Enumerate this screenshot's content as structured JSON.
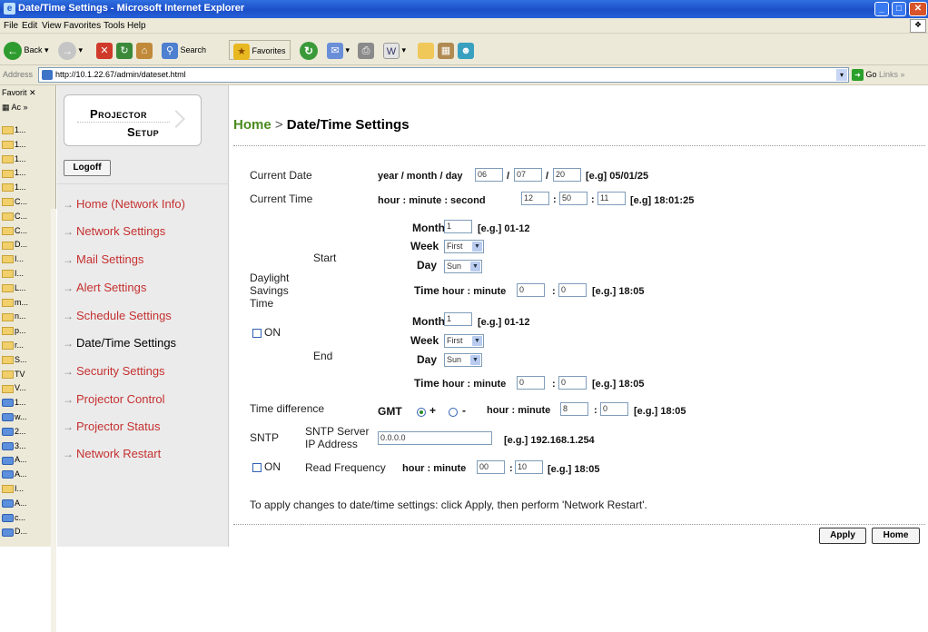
{
  "window": {
    "title": "Date/Time Settings - Microsoft Internet Explorer",
    "icon": "ie-icon"
  },
  "menu": [
    "File",
    "Edit",
    "View",
    "Favorites",
    "Tools",
    "Help"
  ],
  "toolbar": {
    "back": "Back",
    "search": "Search",
    "favorites": "Favorites"
  },
  "address": {
    "label": "Address",
    "url": "http://10.1.22.67/admin/dateset.html",
    "go": "Go",
    "links": "Links"
  },
  "favorites": {
    "header": "Favorit",
    "header2": "Ac",
    "items": [
      "1...",
      "1...",
      "1...",
      "1...",
      "1...",
      "C...",
      "C...",
      "C...",
      "D...",
      "I...",
      "I...",
      "L...",
      "m...",
      "n...",
      "p...",
      "r...",
      "S...",
      "TV",
      "V...",
      "1...",
      "w...",
      "2...",
      "3...",
      "A...",
      "A...",
      "I...",
      "A...",
      "c...",
      "D..."
    ]
  },
  "logo": {
    "line1": "Projector",
    "line2": "Setup"
  },
  "nav": {
    "logoff": "Logoff",
    "items": [
      {
        "label": "Home (Network Info)"
      },
      {
        "label": "Network Settings"
      },
      {
        "label": "Mail Settings"
      },
      {
        "label": "Alert Settings"
      },
      {
        "label": "Schedule Settings"
      },
      {
        "label": "Date/Time Settings"
      },
      {
        "label": "Security Settings"
      },
      {
        "label": "Projector Control"
      },
      {
        "label": "Projector Status"
      },
      {
        "label": "Network Restart"
      }
    ]
  },
  "breadcrumb": {
    "home": "Home",
    "sep": ">",
    "current": "Date/Time Settings"
  },
  "date": {
    "label": "Current Date",
    "prefix": "year / month / day",
    "year": "06",
    "month": "07",
    "day": "20",
    "example": "[e.g] 05/01/25",
    "sep": "/"
  },
  "time": {
    "label": "Current Time",
    "prefix": "hour : minute : second",
    "hour": "12",
    "minute": "50",
    "second": "11",
    "example": "[e.g] 18:01:25",
    "sep": ":"
  },
  "dst": {
    "label_line1": "Daylight",
    "label_line2": "Savings",
    "label_line3": "Time",
    "on_label": "ON",
    "start": {
      "label": "Start",
      "month_label": "Month",
      "month": "1",
      "month_example": "[e.g.] 01-12",
      "week_label": "Week",
      "week": "First",
      "day_label": "Day",
      "day": "Sun",
      "time_label": "Time",
      "time_prefix": "hour : minute",
      "hour": "0",
      "minute": "0",
      "time_example": "[e.g.] 18:05"
    },
    "end": {
      "label": "End",
      "month_label": "Month",
      "month": "1",
      "month_example": "[e.g.] 01-12",
      "week_label": "Week",
      "week": "First",
      "day_label": "Day",
      "day": "Sun",
      "time_label": "Time",
      "time_prefix": "hour : minute",
      "hour": "0",
      "minute": "0",
      "time_example": "[e.g.] 18:05"
    }
  },
  "timediff": {
    "label": "Time difference",
    "gmt": "GMT",
    "plus": "+",
    "minus": "-",
    "selected": "+",
    "prefix": "hour : minute",
    "hour": "8",
    "minute": "0",
    "example": "[e.g.] 18:05"
  },
  "sntp": {
    "label": "SNTP",
    "server_label_1": "SNTP Server",
    "server_label_2": "IP Address",
    "server": "0.0.0.0",
    "server_example": "[e.g.] 192.168.1.254",
    "on_label": "ON",
    "freq_label": "Read Frequency",
    "freq_prefix": "hour : minute",
    "hour": "00",
    "minute": "10",
    "freq_example": "[e.g.] 18:05"
  },
  "note": "To apply changes to date/time settings: click Apply, then perform 'Network Restart'.",
  "buttons": {
    "apply": "Apply",
    "home": "Home"
  }
}
